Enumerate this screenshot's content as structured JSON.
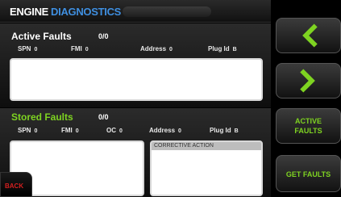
{
  "header": {
    "title_part1": "ENGINE",
    "title_part2": "DIAGNOSTICS"
  },
  "active_faults": {
    "title": "Active Faults",
    "count": "0/0",
    "columns": [
      {
        "label": "SPN",
        "value": "0"
      },
      {
        "label": "FMI",
        "value": "0"
      },
      {
        "label": "Address",
        "value": "0"
      },
      {
        "label": "Plug Id",
        "value": "B"
      }
    ]
  },
  "stored_faults": {
    "title": "Stored Faults",
    "count": "0/0",
    "columns": [
      {
        "label": "SPN",
        "value": "0"
      },
      {
        "label": "FMI",
        "value": "0"
      },
      {
        "label": "OC",
        "value": "0"
      },
      {
        "label": "Address",
        "value": "0"
      },
      {
        "label": "Plug Id",
        "value": "B"
      }
    ],
    "corrective_action_label": "CORRECTIVE ACTION"
  },
  "buttons": {
    "back": "BACK",
    "prev_icon": "chevron-left-icon",
    "next_icon": "chevron-right-icon",
    "active_faults_line1": "ACTIVE",
    "active_faults_line2": "FAULTS",
    "get_faults": "GET FAULTS"
  },
  "colors": {
    "accent_green": "#7ed321",
    "title_blue": "#3f8fe0",
    "back_red": "#d32020"
  }
}
